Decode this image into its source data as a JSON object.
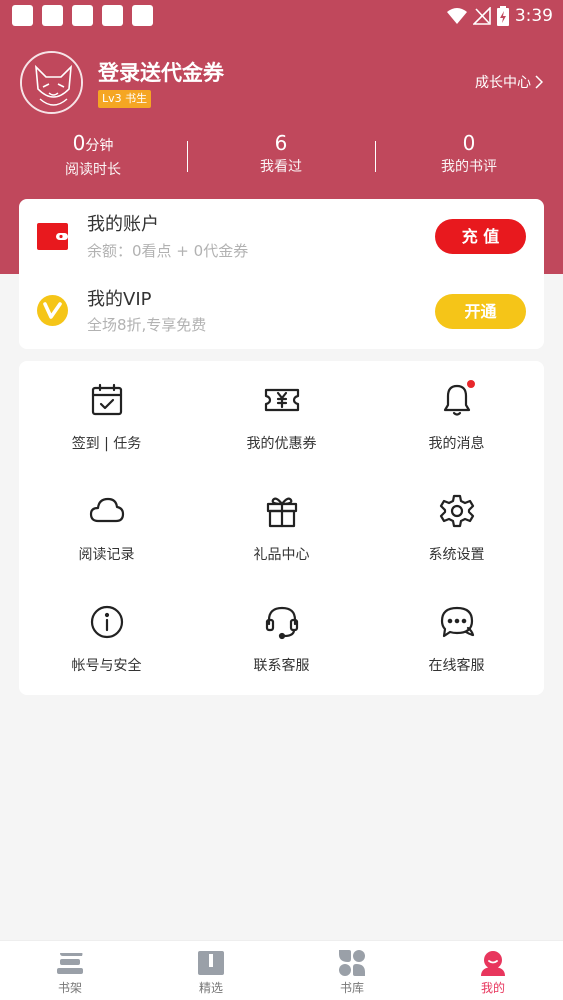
{
  "status_bar": {
    "time": "3:39"
  },
  "profile": {
    "username": "登录送代金券",
    "level_badge": "Lv3 书生",
    "growth_center": "成长中心"
  },
  "stats": [
    {
      "value": "0",
      "unit": "分钟",
      "label": "阅读时长"
    },
    {
      "value": "6",
      "unit": "",
      "label": "我看过"
    },
    {
      "value": "0",
      "unit": "",
      "label": "我的书评"
    }
  ],
  "account": {
    "title": "我的账户",
    "balance": "余额：0看点 + 0代金券",
    "recharge_label": "充 值"
  },
  "vip": {
    "title": "我的VIP",
    "desc": "全场8折,专享免费",
    "open_label": "开通"
  },
  "grid": [
    {
      "label": "签到 | 任务",
      "icon": "calendar-check-icon"
    },
    {
      "label": "我的优惠券",
      "icon": "coupon-icon"
    },
    {
      "label": "我的消息",
      "icon": "bell-icon"
    },
    {
      "label": "阅读记录",
      "icon": "cloud-icon"
    },
    {
      "label": "礼品中心",
      "icon": "gift-icon"
    },
    {
      "label": "系统设置",
      "icon": "gear-icon"
    },
    {
      "label": "帐号与安全",
      "icon": "info-icon"
    },
    {
      "label": "联系客服",
      "icon": "headset-icon"
    },
    {
      "label": "在线客服",
      "icon": "chat-icon"
    }
  ],
  "bottom_nav": [
    {
      "label": "书架",
      "icon": "bookshelf-icon"
    },
    {
      "label": "精选",
      "icon": "featured-icon"
    },
    {
      "label": "书库",
      "icon": "library-icon"
    },
    {
      "label": "我的",
      "icon": "profile-icon",
      "active": true
    }
  ],
  "colors": {
    "header": "#c0485c",
    "recharge_button": "#e8191e",
    "vip_button": "#f5c518",
    "active_tab": "#e8365d",
    "notification_dot": "#e8272b"
  }
}
